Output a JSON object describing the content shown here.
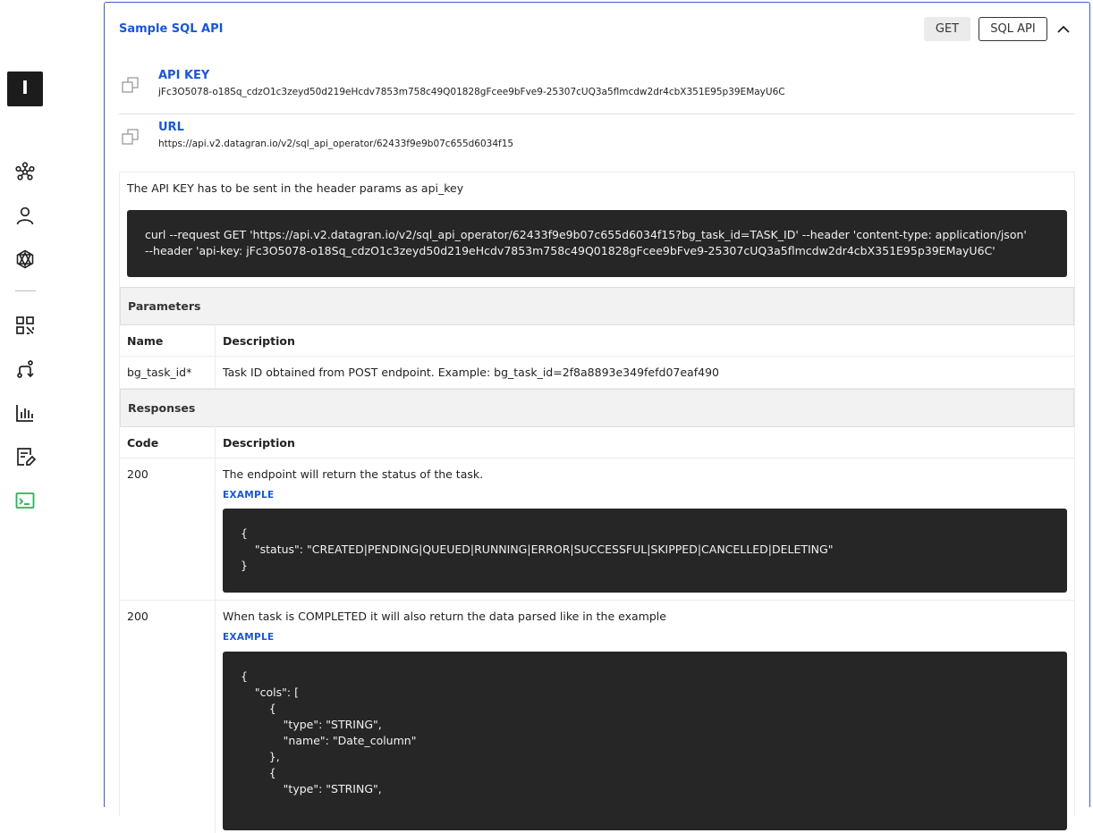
{
  "sidebar": {
    "logo_letter": "I",
    "items": [
      {
        "icon": "network-icon"
      },
      {
        "icon": "user-icon"
      },
      {
        "icon": "starburst-icon"
      },
      {
        "icon": "qr-grid-icon"
      },
      {
        "icon": "route-icon"
      },
      {
        "icon": "bar-chart-icon"
      },
      {
        "icon": "edit-document-icon"
      },
      {
        "icon": "terminal-icon",
        "active": true
      }
    ],
    "active_color": "#1db954"
  },
  "panel": {
    "title": "Sample SQL API",
    "method": "GET",
    "api_type": "SQL API",
    "accent_color": "#1a57d6"
  },
  "api_key": {
    "label": "API KEY",
    "value": "jFc3O5078-o18Sq_cdzO1c3zeyd50d219eHcdv7853m758c49Q01828gFcee9bFve9-25307cUQ3a5flmcdw2dr4cbX351E95p39EMayU6C"
  },
  "url": {
    "label": "URL",
    "value": "https://api.v2.datagran.io/v2/sql_api_operator/62433f9e9b07c655d6034f15"
  },
  "note": "The API KEY has to be sent in the header params as api_key",
  "curl": {
    "line1": "curl --request GET 'https://api.v2.datagran.io/v2/sql_api_operator/62433f9e9b07c655d6034f15?bg_task_id=TASK_ID' --header 'content-type: application/json'",
    "line2": "--header 'api-key: jFc3O5078-o18Sq_cdzO1c3zeyd50d219eHcdv7853m758c49Q01828gFcee9bFve9-25307cUQ3a5flmcdw2dr4cbX351E95p39EMayU6C'"
  },
  "parameters": {
    "heading": "Parameters",
    "col_name": "Name",
    "col_desc": "Description",
    "rows": [
      {
        "name": "bg_task_id*",
        "desc": "Task ID obtained from POST endpoint. Example: bg_task_id=2f8a8893e349fefd07eaf490"
      }
    ]
  },
  "responses": {
    "heading": "Responses",
    "col_code": "Code",
    "col_desc": "Description",
    "example_label": "EXAMPLE",
    "rows": [
      {
        "code": "200",
        "desc": "The endpoint will return the status of the task.",
        "example_lines": [
          "{",
          "    \"status\": \"CREATED|PENDING|QUEUED|RUNNING|ERROR|SUCCESSFUL|SKIPPED|CANCELLED|DELETING\"",
          "}"
        ]
      },
      {
        "code": "200",
        "desc": "When task is COMPLETED it will also return the data parsed like in the example",
        "example_lines": [
          "{",
          "    \"cols\": [",
          "        {",
          "            \"type\": \"STRING\",",
          "            \"name\": \"Date_column\"",
          "        },",
          "        {",
          "            \"type\": \"STRING\","
        ]
      }
    ]
  }
}
